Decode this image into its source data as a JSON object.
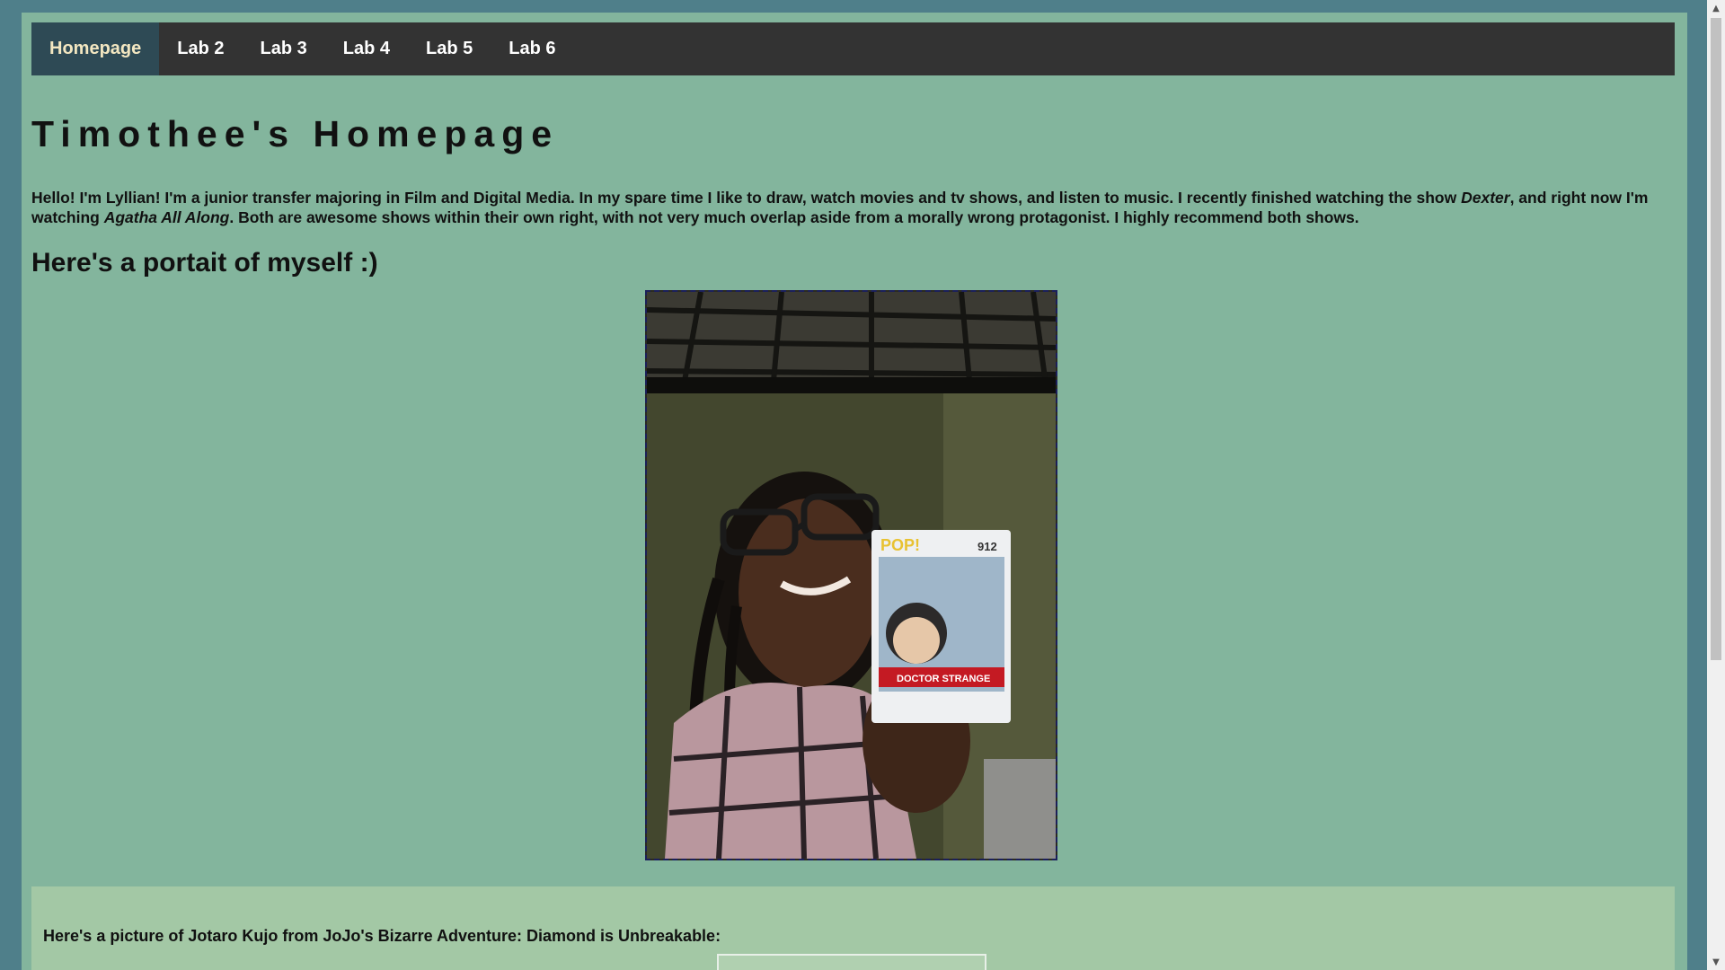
{
  "nav": {
    "items": [
      {
        "label": "Homepage",
        "active": true
      },
      {
        "label": "Lab 2",
        "active": false
      },
      {
        "label": "Lab 3",
        "active": false
      },
      {
        "label": "Lab 4",
        "active": false
      },
      {
        "label": "Lab 5",
        "active": false
      },
      {
        "label": "Lab 6",
        "active": false
      }
    ]
  },
  "main": {
    "title": "Timothee's Homepage",
    "intro": {
      "part1": "Hello! I'm Lyllian! I'm a junior transfer majoring in Film and Digital Media. In my spare time I like to draw, watch movies and tv shows, and listen to music. I recently finished watching the show ",
      "show1": "Dexter",
      "part2": ", and right now I'm watching ",
      "show2": "Agatha All Along",
      "part3": ". Both are awesome shows within their own right, with not very much overlap aside from a morally wrong protagonist. I highly recommend both shows."
    },
    "portrait_heading": "Here's a portait of myself :)",
    "second_section": {
      "caption": "Here's a picture of Jotaro Kujo from JoJo's Bizarre Adventure: Diamond is Unbreakable:"
    }
  },
  "colors": {
    "window_bg": "#4f7f8a",
    "page_bg": "#83b59d",
    "nav_bg": "#333333",
    "nav_active_bg": "#2e4a55",
    "nav_active_text": "#f3e7c1",
    "section_bg": "#a3c8a5",
    "portrait_border": "#1b1f5a"
  },
  "scrollbar": {
    "up_icon": "triangle-up-icon",
    "down_icon": "triangle-down-icon"
  }
}
